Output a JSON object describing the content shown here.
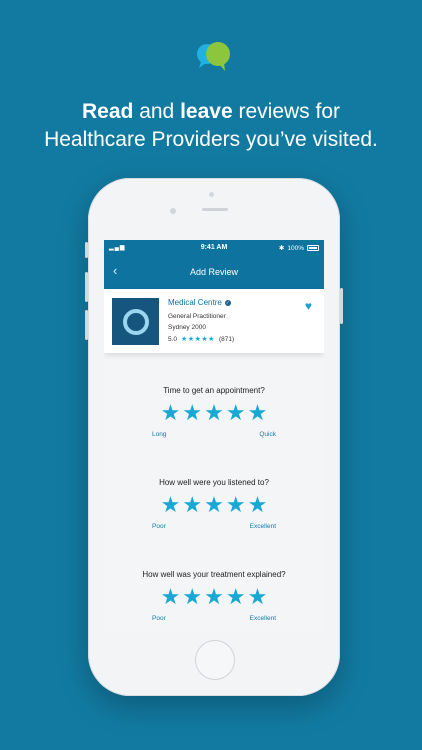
{
  "headline": {
    "read": "Read",
    "and": " and ",
    "leave": "leave",
    "rest1": " reviews for",
    "line2": "Healthcare Providers you’ve visited."
  },
  "status_bar": {
    "signal": "▂▄▆",
    "time": "9:41 AM",
    "bluetooth": "✱",
    "battery": "100%"
  },
  "nav": {
    "back_icon": "‹",
    "title": "Add Review"
  },
  "provider": {
    "name": "Medical Centre",
    "type": "General Practitioner",
    "location": "Sydney 2000",
    "rating": "5.0",
    "stars": "★★★★★",
    "reviews": "(871)",
    "heart": "♥"
  },
  "questions": [
    {
      "label": "Time to get an appointment?",
      "stars": 5,
      "low": "Long",
      "high": "Quick"
    },
    {
      "label": "How well were you listened to?",
      "stars": 5,
      "low": "Poor",
      "high": "Excellent"
    },
    {
      "label": "How well was your treatment explained?",
      "stars": 5,
      "low": "Poor",
      "high": "Excellent"
    }
  ],
  "colors": {
    "background": "#127aa1",
    "accent": "#17a8d6",
    "appbar": "#0f73a0"
  }
}
